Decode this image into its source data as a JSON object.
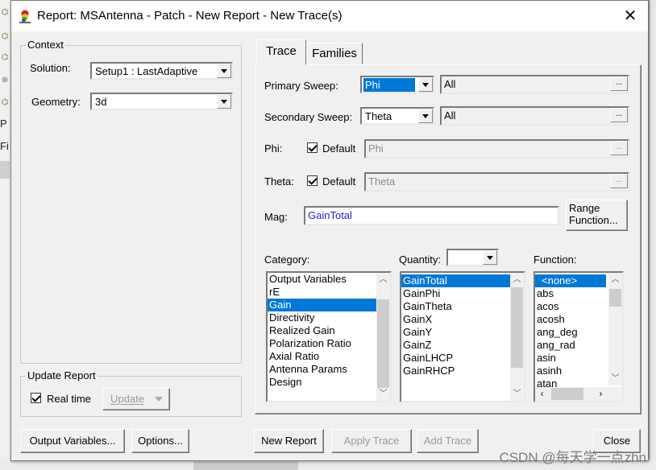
{
  "window": {
    "title": "Report: MSAntenna - Patch - New Report - New Trace(s)",
    "close_icon": "close-icon",
    "app_icon": "hfss-app-icon"
  },
  "background": {
    "left_text_1": "P",
    "left_text_2": "Fi"
  },
  "context": {
    "group_label": "Context",
    "solution_label": "Solution:",
    "solution_value": "Setup1 : LastAdaptive",
    "geometry_label": "Geometry:",
    "geometry_value": "3d"
  },
  "update_report": {
    "group_label": "Update Report",
    "realtime_label": "Real time",
    "realtime_checked": true,
    "update_button": "Update"
  },
  "tabs": [
    {
      "label": "Trace",
      "active": true
    },
    {
      "label": "Families",
      "active": false
    }
  ],
  "trace": {
    "primary_sweep_label": "Primary Sweep:",
    "primary_sweep_value": "Phi",
    "primary_sweep_range": "All",
    "secondary_sweep_label": "Secondary Sweep:",
    "secondary_sweep_value": "Theta",
    "secondary_sweep_range": "All",
    "ellipsis": "...",
    "phi_label": "Phi:",
    "phi_default_label": "Default",
    "phi_default_checked": true,
    "phi_value": "Phi",
    "theta_label": "Theta:",
    "theta_default_label": "Default",
    "theta_default_checked": true,
    "theta_value": "Theta",
    "mag_label": "Mag:",
    "mag_value": "GainTotal",
    "range_function_button": [
      "Range",
      "Function..."
    ],
    "category_label": "Category:",
    "categories": [
      "Output Variables",
      "rE",
      "Gain",
      "Directivity",
      "Realized Gain",
      "Polarization Ratio",
      "Axial Ratio",
      "Antenna Params",
      "Design"
    ],
    "category_selected": "Gain",
    "quantity_label": "Quantity:",
    "quantity_filter": "",
    "quantities": [
      "GainTotal",
      "GainPhi",
      "GainTheta",
      "GainX",
      "GainY",
      "GainZ",
      "GainLHCP",
      "GainRHCP"
    ],
    "quantity_selected": "GainTotal",
    "function_label": "Function:",
    "functions": [
      "<none>",
      "abs",
      "acos",
      "acosh",
      "ang_deg",
      "ang_rad",
      "asin",
      "asinh",
      "atan"
    ],
    "function_selected": "<none>"
  },
  "buttons": {
    "output_variables": "Output Variables...",
    "options": "Options...",
    "new_report": "New Report",
    "apply_trace": "Apply Trace",
    "add_trace": "Add Trace",
    "close": "Close"
  },
  "watermark": "CSDN @每天学一点zhn",
  "colors": {
    "selection": "#0078d7",
    "mag_text": "#1f1fdd",
    "dialog_bg": "#f0f0f0"
  }
}
